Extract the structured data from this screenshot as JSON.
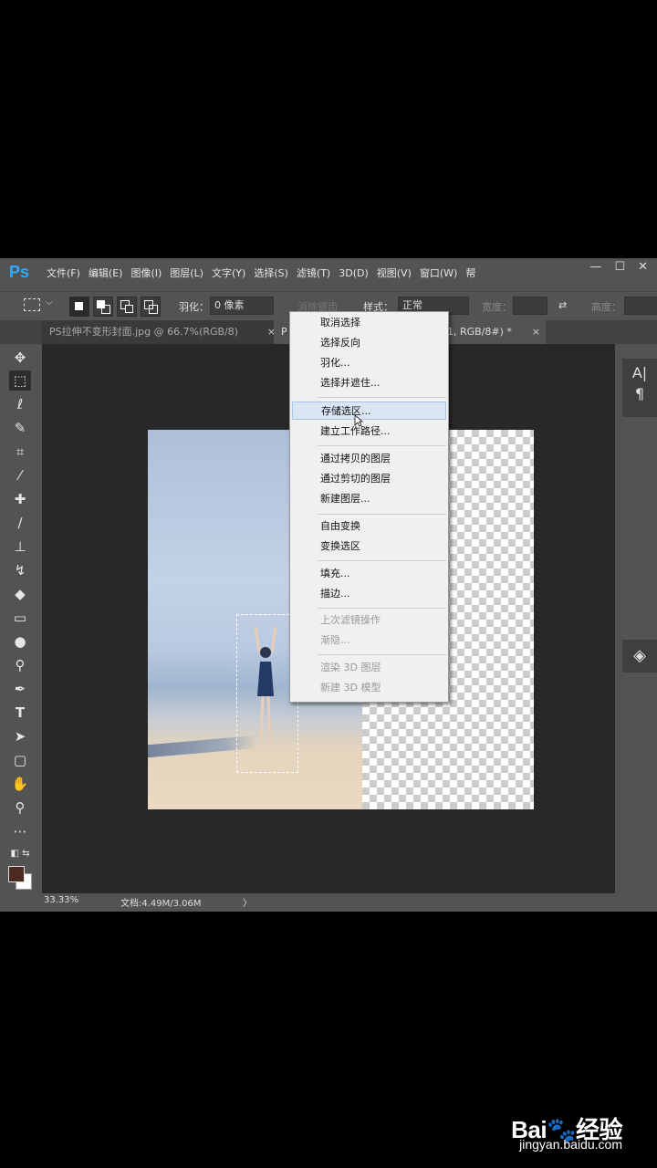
{
  "app": {
    "logo": "Ps"
  },
  "menubar": {
    "items": [
      "文件(F)",
      "编辑(E)",
      "图像(I)",
      "图层(L)",
      "文字(Y)",
      "选择(S)",
      "滤镜(T)",
      "3D(D)",
      "视图(V)",
      "窗口(W)",
      "帮"
    ],
    "window_controls": [
      "—",
      "☐",
      "✕"
    ]
  },
  "options": {
    "feather_label": "羽化：",
    "feather_value": "0 像素",
    "antialias_label": "消除锯齿",
    "style_label": "样式：",
    "style_value": "正常",
    "width_label": "宽度：",
    "height_label": "高度："
  },
  "tabs": {
    "inactive": "PS拉伸不变形封面.jpg @ 66.7%(RGB/8)",
    "active_prefix": "P",
    "active_suffix": "1, RGB/8#) *",
    "close": "×"
  },
  "context_menu": {
    "items": [
      {
        "label": "取消选择",
        "disabled": false
      },
      {
        "label": "选择反向",
        "disabled": false
      },
      {
        "label": "羽化...",
        "disabled": false
      },
      {
        "label": "选择并遮住...",
        "disabled": false
      },
      {
        "label": "存储选区...",
        "disabled": false,
        "hover": true
      },
      {
        "label": "建立工作路径...",
        "disabled": false
      },
      {
        "label": "通过拷贝的图层",
        "disabled": false
      },
      {
        "label": "通过剪切的图层",
        "disabled": false
      },
      {
        "label": "新建图层...",
        "disabled": false
      },
      {
        "label": "自由变换",
        "disabled": false
      },
      {
        "label": "变换选区",
        "disabled": false
      },
      {
        "label": "填充...",
        "disabled": false
      },
      {
        "label": "描边...",
        "disabled": false
      },
      {
        "label": "上次滤镜操作",
        "disabled": true
      },
      {
        "label": "渐隐...",
        "disabled": true
      },
      {
        "label": "渲染 3D 图层",
        "disabled": true
      },
      {
        "label": "新建 3D 模型",
        "disabled": true
      }
    ]
  },
  "status": {
    "zoom": "33.33%",
    "doc": "文档:4.49M/3.06M",
    "arrow": "〉"
  },
  "right_panel": {
    "char_icon": "A|",
    "para_icon": "¶"
  },
  "watermark": {
    "brand": "Bai",
    "brand2": "经验",
    "url": "jingyan.baidu.com"
  },
  "colors": {
    "accent": "#31a8ff",
    "foreground_swatch": "#4a2a22"
  }
}
